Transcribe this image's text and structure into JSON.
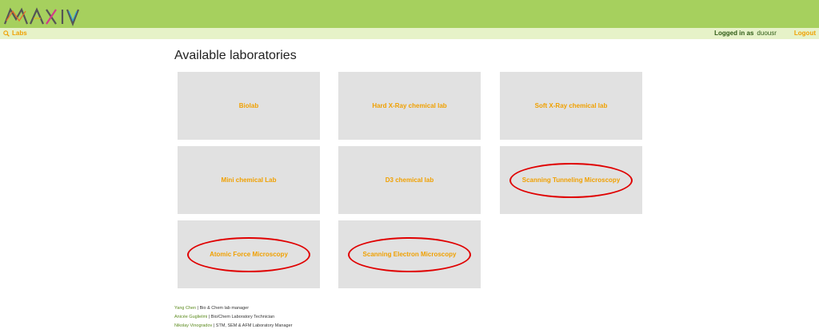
{
  "brand": {
    "logo_text": "MAX IV"
  },
  "colors": {
    "header": "#a6d05e",
    "navbar": "#e6f2c8",
    "accent": "#f0a000",
    "tile": "#e1e1e1",
    "annotation": "#e00000"
  },
  "nav": {
    "labs_label": "Labs",
    "labs_icon": "magnifier-icon",
    "logged_in_label": "Logged in as",
    "username": "duousr",
    "logout_label": "Logout"
  },
  "page": {
    "title": "Available laboratories"
  },
  "labs": [
    {
      "label": "Biolab",
      "highlighted": false
    },
    {
      "label": "Hard X-Ray chemical lab",
      "highlighted": false
    },
    {
      "label": "Soft X-Ray chemical lab",
      "highlighted": false
    },
    {
      "label": "Mini chemical Lab",
      "highlighted": false
    },
    {
      "label": "D3 chemical lab",
      "highlighted": false
    },
    {
      "label": "Scanning Tunneling Microscopy",
      "highlighted": true
    },
    {
      "label": "Atomic Force Microscopy",
      "highlighted": true
    },
    {
      "label": "Scanning Electron Microscopy",
      "highlighted": true
    }
  ],
  "staff": [
    {
      "name": "Yang Chen",
      "role": "| Bio & Chem lab manager"
    },
    {
      "name": "Anicée Guglielmi",
      "role": "| Bio/Chem Laboratory Technician"
    },
    {
      "name": "Nikolay Vinogradov",
      "role": "| STM, SEM & AFM Laboratory Manager"
    }
  ]
}
